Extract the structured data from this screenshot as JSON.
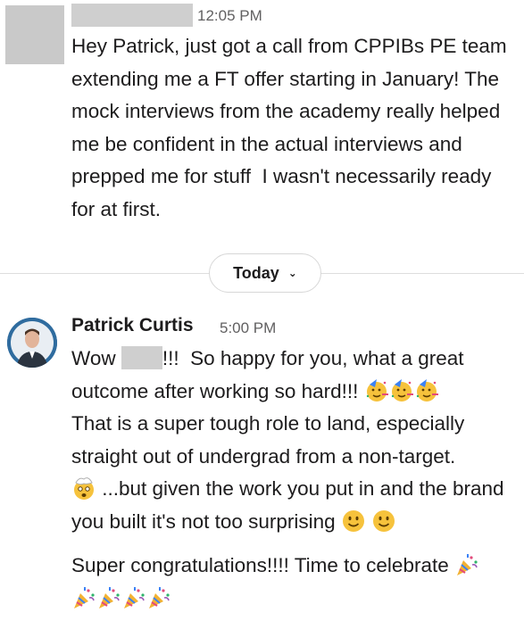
{
  "message1": {
    "time": "12:05 PM",
    "text": "Hey Patrick, just got a call from CPPIBs PE team extending me a FT offer starting in January! The mock interviews from the academy really helped me be confident in the actual interviews and prepped me for stuff  I wasn't necessarily ready for at first."
  },
  "divider": {
    "label": "Today"
  },
  "message2": {
    "sender": "Patrick Curtis",
    "time": "5:00 PM",
    "p1_a": "Wow ",
    "p1_b": "!!!  So happy for you, what a great outcome after working so hard!!! ",
    "p1_c": "That is a super tough role to land, especially straight out of undergrad from a non-target. ",
    "p1_d": " ...but given the work you put in and the brand you built it's not too surprising ",
    "p2": "Super congratulations!!!! Time to celebrate ",
    "icons": {
      "party_face": "partying-face-emoji",
      "exploding_head": "exploding-head-emoji",
      "smile": "slightly-smiling-face-emoji",
      "popper": "party-popper-emoji"
    }
  }
}
